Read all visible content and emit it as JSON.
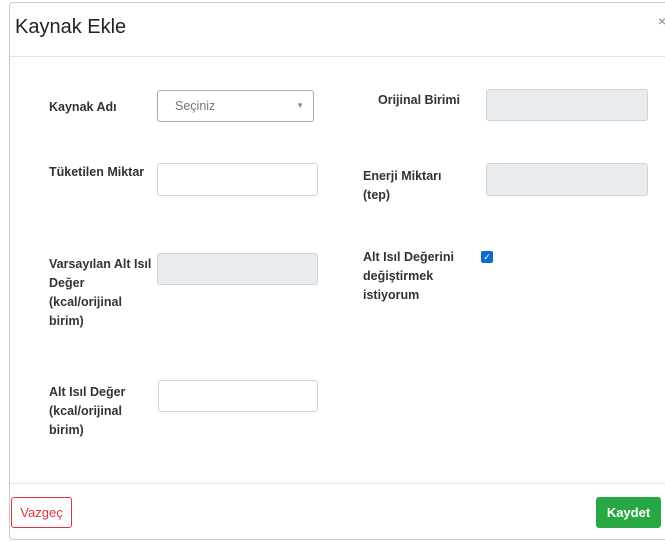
{
  "modal": {
    "title": "Kaynak Ekle",
    "close_glyph": "×"
  },
  "form": {
    "kaynak_adi_label": "Kaynak Adı",
    "kaynak_adi_select_value": "Seçiniz",
    "orijinal_birimi_label": "Orijinal Birimi",
    "orijinal_birimi_value": "",
    "tuketilen_miktar_label": "Tüketilen Miktar",
    "tuketilen_miktar_value": "",
    "enerji_miktari_label_line1": "Enerji Miktarı",
    "enerji_miktari_label_line2": "(tep)",
    "enerji_miktari_value": "",
    "varsayilan_alt_isil_label_lines": [
      "Varsayılan Alt Isıl",
      "Değer",
      "(kcal/orijinal",
      "birim)"
    ],
    "varsayilan_alt_isil_value": "",
    "degistir_checkbox_label_lines": [
      "Alt Isıl Değerini",
      "değiştirmek",
      "istiyorum"
    ],
    "degistir_checked": true,
    "alt_isil_deger_label_lines": [
      "Alt Isıl Değer",
      "(kcal/orijinal",
      "birim)"
    ],
    "alt_isil_deger_value": ""
  },
  "footer": {
    "cancel_label": "Vazgeç",
    "save_label": "Kaydet"
  },
  "colors": {
    "cancel": "#dc3545",
    "save": "#28a745",
    "checkbox": "#0b6bcb"
  }
}
